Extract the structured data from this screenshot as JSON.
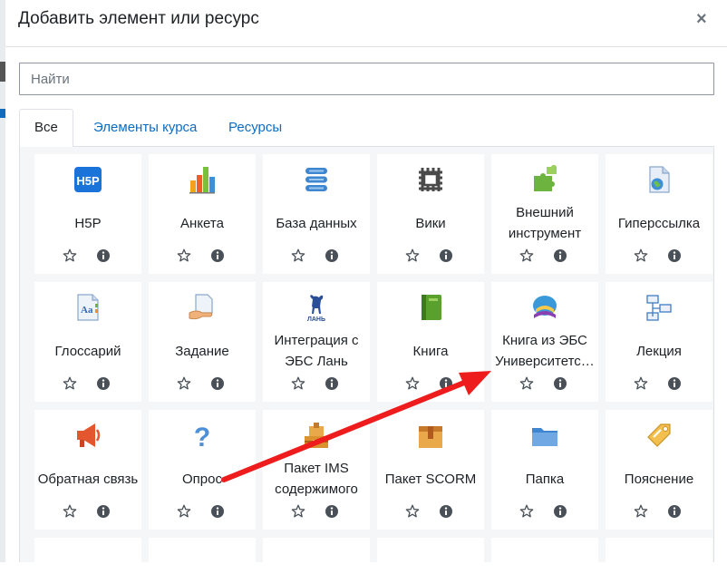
{
  "dialog": {
    "title": "Добавить элемент или ресурс",
    "close_symbol": "×",
    "search_placeholder": "Найти"
  },
  "tabs": [
    {
      "label": "Все",
      "active": true
    },
    {
      "label": "Элементы курса",
      "active": false
    },
    {
      "label": "Ресурсы",
      "active": false
    }
  ],
  "modules": [
    {
      "label": "H5P",
      "icon": "h5p-icon"
    },
    {
      "label": "Анкета",
      "icon": "chart-icon"
    },
    {
      "label": "База данных",
      "icon": "database-icon"
    },
    {
      "label": "Вики",
      "icon": "wiki-icon"
    },
    {
      "label": "Внешний инструмент",
      "icon": "puzzle-icon"
    },
    {
      "label": "Гиперссылка",
      "icon": "url-icon"
    },
    {
      "label": "Глоссарий",
      "icon": "glossary-icon"
    },
    {
      "label": "Задание",
      "icon": "assignment-icon"
    },
    {
      "label": "Интеграция с ЭБС Лань",
      "icon": "lan-icon"
    },
    {
      "label": "Книга",
      "icon": "book-icon"
    },
    {
      "label": "Книга из ЭБС Университетс…",
      "icon": "ebs-book-icon"
    },
    {
      "label": "Лекция",
      "icon": "lesson-icon"
    },
    {
      "label": "Обратная связь",
      "icon": "feedback-icon"
    },
    {
      "label": "Опрос",
      "icon": "question-icon"
    },
    {
      "label": "Пакет IMS содержимого",
      "icon": "ims-package-icon"
    },
    {
      "label": "Пакет SCORM",
      "icon": "scorm-icon"
    },
    {
      "label": "Папка",
      "icon": "folder-icon"
    },
    {
      "label": "Пояснение",
      "icon": "label-icon"
    }
  ],
  "annotation": {
    "color": "#ee1c1c"
  }
}
